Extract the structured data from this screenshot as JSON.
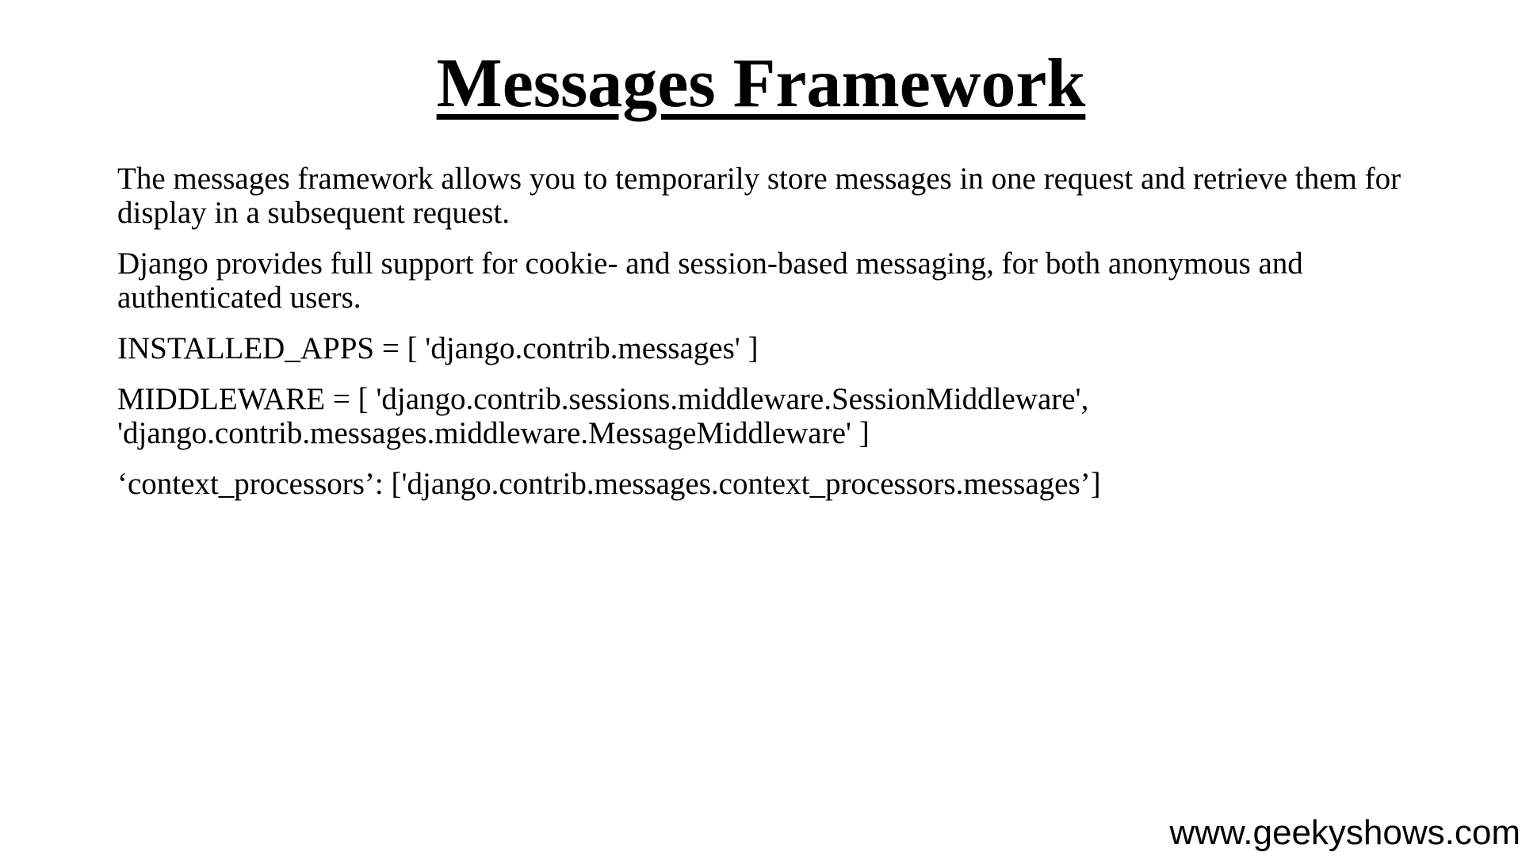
{
  "slide": {
    "title": "Messages Framework",
    "paragraphs": [
      "The messages framework allows you to temporarily store messages in one request and retrieve them for display in a subsequent request.",
      "Django provides full support for cookie- and session-based messaging, for both anonymous and authenticated users.",
      "INSTALLED_APPS = [ 'django.contrib.messages' ]",
      "MIDDLEWARE = [ 'django.contrib.sessions.middleware.SessionMiddleware', 'django.contrib.messages.middleware.MessageMiddleware' ]",
      "‘context_processors’: ['django.contrib.messages.context_processors.messages’]"
    ],
    "footer": "www.geekyshows.com"
  }
}
